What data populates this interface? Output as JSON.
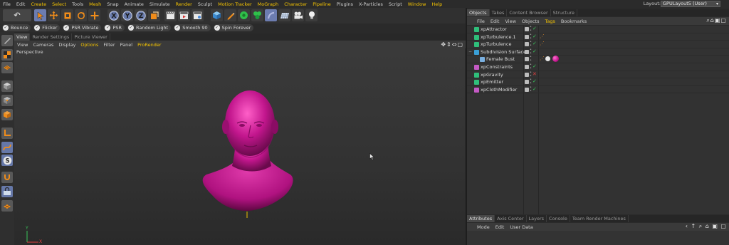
{
  "menubar": {
    "items": [
      {
        "label": "File",
        "hl": false
      },
      {
        "label": "Edit",
        "hl": false
      },
      {
        "label": "Create",
        "hl": true
      },
      {
        "label": "Select",
        "hl": true
      },
      {
        "label": "Tools",
        "hl": false
      },
      {
        "label": "Mesh",
        "hl": true
      },
      {
        "label": "Snap",
        "hl": false
      },
      {
        "label": "Animate",
        "hl": false
      },
      {
        "label": "Simulate",
        "hl": false
      },
      {
        "label": "Render",
        "hl": true
      },
      {
        "label": "Sculpt",
        "hl": false
      },
      {
        "label": "Motion Tracker",
        "hl": true
      },
      {
        "label": "MoGraph",
        "hl": true
      },
      {
        "label": "Character",
        "hl": true
      },
      {
        "label": "Pipeline",
        "hl": true
      },
      {
        "label": "Plugins",
        "hl": false
      },
      {
        "label": "X-Particles",
        "hl": false
      },
      {
        "label": "Script",
        "hl": false
      },
      {
        "label": "Window",
        "hl": true
      },
      {
        "label": "Help",
        "hl": true
      }
    ],
    "layout_label": "Layout:",
    "layout_value": "GPULayout5 (User)"
  },
  "toolbar": {
    "undo_icon": "undo-icon",
    "axis_x": "X",
    "axis_y": "Y",
    "axis_z": "Z"
  },
  "presets": [
    {
      "label": "Bounce"
    },
    {
      "label": "Flicker"
    },
    {
      "label": "PSR Vibrate"
    },
    {
      "label": "PSR"
    },
    {
      "label": "Random Light"
    },
    {
      "label": "Smooth 90"
    },
    {
      "label": "Spin Forever"
    }
  ],
  "viewport_tabs": [
    {
      "label": "View",
      "active": true
    },
    {
      "label": "Render Settings",
      "active": false
    },
    {
      "label": "Picture Viewer",
      "active": false
    }
  ],
  "viewport_menu": [
    {
      "label": "View",
      "hl": false
    },
    {
      "label": "Cameras",
      "hl": false
    },
    {
      "label": "Display",
      "hl": false
    },
    {
      "label": "Options",
      "hl": true
    },
    {
      "label": "Filter",
      "hl": false
    },
    {
      "label": "Panel",
      "hl": false
    },
    {
      "label": "ProRender",
      "hl": true
    }
  ],
  "viewport": {
    "camera_label": "Perspective",
    "model_color": "#c2168d",
    "axis_y": "Y",
    "axis_x": "X"
  },
  "objects_tabs": [
    {
      "label": "Objects",
      "active": true
    },
    {
      "label": "Takes",
      "active": false
    },
    {
      "label": "Content Browser",
      "active": false
    },
    {
      "label": "Structure",
      "active": false
    }
  ],
  "objects_menu": [
    {
      "label": "File",
      "hl": false
    },
    {
      "label": "Edit",
      "hl": false
    },
    {
      "label": "View",
      "hl": false
    },
    {
      "label": "Objects",
      "hl": false
    },
    {
      "label": "Tags",
      "hl": true
    },
    {
      "label": "Bookmarks",
      "hl": false
    }
  ],
  "objects": [
    {
      "name": "xpAttractor",
      "icon_color": "#2fbf7a",
      "status": "✓",
      "status_color": "#3ac45a",
      "indent": 0,
      "tag": ""
    },
    {
      "name": "xpTurbulence.1",
      "icon_color": "#2fbf7a",
      "status": "✓",
      "status_color": "#3ac45a",
      "indent": 0,
      "tag": "•"
    },
    {
      "name": "xpTurbulence",
      "icon_color": "#2fbf7a",
      "status": "✓",
      "status_color": "#3ac45a",
      "indent": 0,
      "tag": "•"
    },
    {
      "name": "Subdivision Surface",
      "icon_color": "#3a9fd6",
      "status": "✓",
      "status_color": "#3ac45a",
      "indent": 0,
      "tag": ""
    },
    {
      "name": "Female Bust",
      "icon_color": "#7ab0e0",
      "status": "",
      "status_color": "#3ac45a",
      "indent": 1,
      "tag": "•"
    },
    {
      "name": "xpConstraints",
      "icon_color": "#c45ac4",
      "status": "✓",
      "status_color": "#3ac45a",
      "indent": 0,
      "tag": ""
    },
    {
      "name": "xpGravity",
      "icon_color": "#2fbf7a",
      "status": "✕",
      "status_color": "#e04040",
      "indent": 0,
      "tag": ""
    },
    {
      "name": "xpEmitter",
      "icon_color": "#2fbf7a",
      "status": "✓",
      "status_color": "#3ac45a",
      "indent": 0,
      "tag": ""
    },
    {
      "name": "xpClothModifier",
      "icon_color": "#c45ac4",
      "status": "✓",
      "status_color": "#3ac45a",
      "indent": 0,
      "tag": ""
    }
  ],
  "attributes_tabs": [
    {
      "label": "Attributes",
      "active": true
    },
    {
      "label": "Axis Center",
      "active": false
    },
    {
      "label": "Layers",
      "active": false
    },
    {
      "label": "Console",
      "active": false
    },
    {
      "label": "Team Render Machines",
      "active": false
    }
  ],
  "attributes_menu": [
    {
      "label": "Mode"
    },
    {
      "label": "Edit"
    },
    {
      "label": "User Data"
    }
  ]
}
